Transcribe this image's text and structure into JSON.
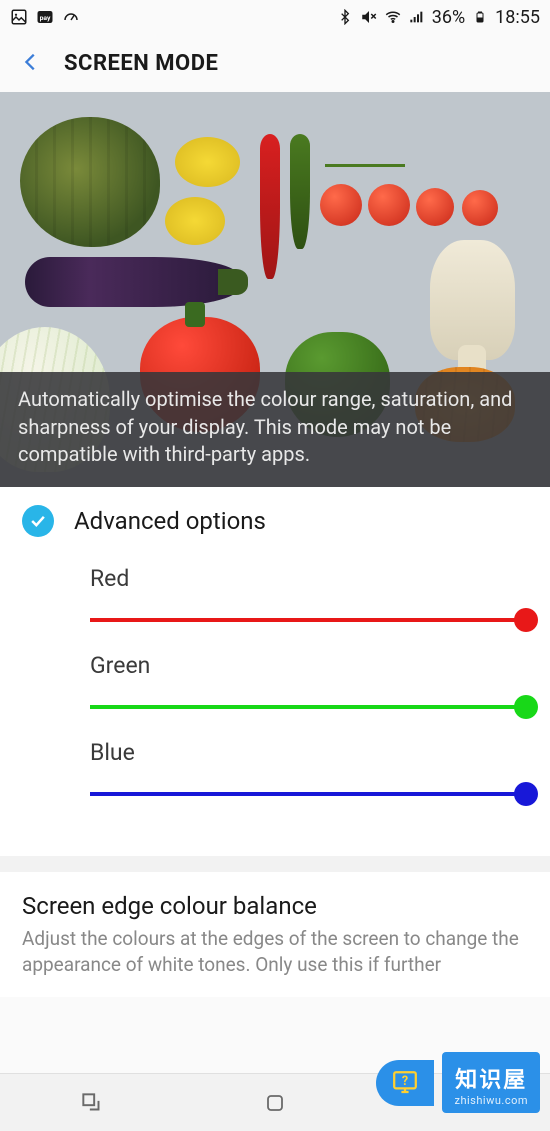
{
  "status_bar": {
    "battery_pct": "36%",
    "time": "18:55"
  },
  "header": {
    "title": "SCREEN MODE"
  },
  "hero": {
    "caption": "Automatically optimise the colour range, saturation, and sharpness of your display. This mode may not be compatible with third-party apps."
  },
  "advanced": {
    "label": "Advanced options",
    "checked": true,
    "sliders": [
      {
        "label": "Red",
        "color": "#e81818",
        "value": 100
      },
      {
        "label": "Green",
        "color": "#18d818",
        "value": 100
      },
      {
        "label": "Blue",
        "color": "#1818d8",
        "value": 100
      }
    ]
  },
  "edge_balance": {
    "title": "Screen edge colour balance",
    "description": "Adjust the colours at the edges of the screen to change the appearance of white tones. Only use this if further"
  },
  "watermark": {
    "main": "知识屋",
    "sub": "zhishiwu.com"
  }
}
